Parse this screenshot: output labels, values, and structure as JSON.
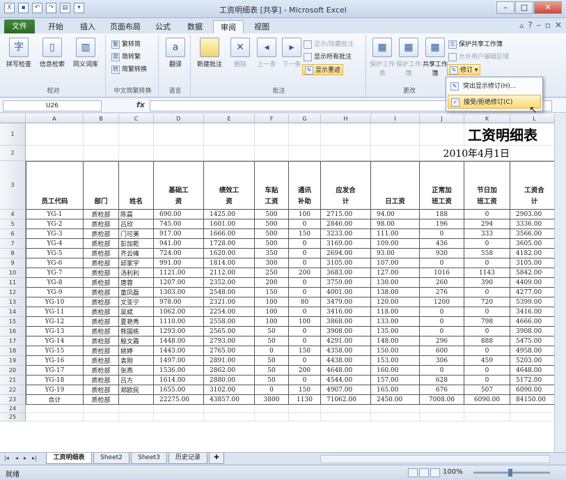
{
  "window": {
    "title": "工资明细表 [共享] - Microsoft Excel"
  },
  "qat": {
    "save_icon": "save-icon",
    "undo_icon": "undo-icon",
    "redo_icon": "redo-icon"
  },
  "tabs": {
    "file": "文件",
    "items": [
      "开始",
      "插入",
      "页面布局",
      "公式",
      "数据",
      "审阅",
      "视图"
    ],
    "active": "审阅"
  },
  "ribbon": {
    "proofing": {
      "label": "校对",
      "spell": "拼写检查",
      "research": "信息检索",
      "thesaurus": "同义词库"
    },
    "chinese": {
      "label": "中文简繁转换",
      "to_simplified": "繁转简",
      "to_traditional": "简转繁",
      "convert": "简繁转换"
    },
    "language": {
      "label": "语言",
      "translate": "翻译"
    },
    "comments": {
      "label": "批注",
      "new": "新建批注",
      "delete": "删除",
      "prev": "上一条",
      "next": "下一条",
      "show_hide": "显示/隐藏批注",
      "show_all": "显示所有批注",
      "show_ink": "显示墨迹"
    },
    "changes": {
      "label": "更改",
      "protect_sheet": "保护工作表",
      "protect_book": "保护工作簿",
      "share_book": "共享工作簿",
      "protect_share": "保护共享工作簿",
      "allow_edit": "允许用户编辑区域",
      "track": "修订"
    }
  },
  "dropdown": {
    "highlight": "突出显示修订(H)...",
    "accept": "接受/拒绝修订(C)"
  },
  "formula": {
    "namebox": "U26",
    "fx": "fx",
    "value": ""
  },
  "columns": [
    "A",
    "B",
    "C",
    "D",
    "E",
    "F",
    "G",
    "H",
    "I",
    "J",
    "K",
    "L"
  ],
  "rows": [
    "1",
    "2",
    "3",
    "4",
    "5",
    "6",
    "7",
    "8",
    "9",
    "10",
    "11",
    "12",
    "13",
    "14",
    "15",
    "16",
    "17",
    "18",
    "19",
    "20",
    "21",
    "22",
    "23",
    "24",
    "25"
  ],
  "sheet": {
    "title": "工资明细表",
    "date": "2010年4月1日",
    "headers": [
      [
        "员工代码"
      ],
      [
        "部门"
      ],
      [
        "姓名"
      ],
      [
        "基础工",
        "资"
      ],
      [
        "绩效工",
        "资"
      ],
      [
        "车贴",
        "工资"
      ],
      [
        "通讯",
        "补助"
      ],
      [
        "应发合",
        "计"
      ],
      [
        "日工资"
      ],
      [
        "正常加",
        "班工资"
      ],
      [
        "节日加",
        "班工资"
      ],
      [
        "工资合",
        "计"
      ]
    ],
    "data": [
      [
        "YG-1",
        "质检部",
        "陈晨",
        "690.00",
        "1425.00",
        "500",
        "100",
        "2715.00",
        "94.00",
        "188",
        "0",
        "2903.00"
      ],
      [
        "YG-2",
        "质检部",
        "吕欣",
        "745.00",
        "1601.00",
        "500",
        "0",
        "2846.00",
        "98.00",
        "196",
        "294",
        "3336.00"
      ],
      [
        "YG-3",
        "质检部",
        "门可美",
        "917.00",
        "1666.00",
        "500",
        "150",
        "3233.00",
        "111.00",
        "0",
        "333",
        "3566.00"
      ],
      [
        "YG-4",
        "质检部",
        "彭加乾",
        "941.00",
        "1728.00",
        "500",
        "0",
        "3169.00",
        "109.00",
        "436",
        "0",
        "3605.00"
      ],
      [
        "YG-5",
        "质检部",
        "齐云峰",
        "724.00",
        "1620.00",
        "350",
        "0",
        "2694.00",
        "93.00",
        "930",
        "558",
        "4182.00"
      ],
      [
        "YG-6",
        "质检部",
        "邱家宇",
        "991.00",
        "1814.00",
        "300",
        "0",
        "3105.00",
        "107.00",
        "0",
        "0",
        "3105.00"
      ],
      [
        "YG-7",
        "质检部",
        "汤利利",
        "1121.00",
        "2112.00",
        "250",
        "200",
        "3683.00",
        "127.00",
        "1016",
        "1143",
        "5842.00"
      ],
      [
        "YG-8",
        "质检部",
        "唐蓉",
        "1207.00",
        "2352.00",
        "200",
        "0",
        "3759.00",
        "130.00",
        "260",
        "390",
        "4409.00"
      ],
      [
        "YG-9",
        "质检部",
        "童凤磊",
        "1303.00",
        "2548.00",
        "150",
        "0",
        "4001.00",
        "138.00",
        "276",
        "0",
        "4277.00"
      ],
      [
        "YG-10",
        "质检部",
        "文亚宁",
        "978.00",
        "2321.00",
        "100",
        "80",
        "3479.00",
        "120.00",
        "1200",
        "720",
        "5399.00"
      ],
      [
        "YG-11",
        "质检部",
        "吴斌",
        "1062.00",
        "2254.00",
        "100",
        "0",
        "3416.00",
        "118.00",
        "0",
        "0",
        "3416.00"
      ],
      [
        "YG-12",
        "质检部",
        "夏艳秀",
        "1110.00",
        "2558.00",
        "100",
        "100",
        "3868.00",
        "133.00",
        "0",
        "798",
        "4666.00"
      ],
      [
        "YG-13",
        "质检部",
        "熊国栋",
        "1293.00",
        "2565.00",
        "50",
        "0",
        "3908.00",
        "135.00",
        "0",
        "0",
        "3908.00"
      ],
      [
        "YG-14",
        "质检部",
        "殷文霞",
        "1448.00",
        "2793.00",
        "50",
        "0",
        "4291.00",
        "148.00",
        "296",
        "888",
        "5475.00"
      ],
      [
        "YG-15",
        "质检部",
        "姚婷",
        "1443.00",
        "2765.00",
        "0",
        "150",
        "4358.00",
        "150.00",
        "600",
        "0",
        "4958.00"
      ],
      [
        "YG-16",
        "质检部",
        "袁刚",
        "1497.00",
        "2891.00",
        "50",
        "0",
        "4438.00",
        "153.00",
        "306",
        "459",
        "5203.00"
      ],
      [
        "YG-17",
        "质检部",
        "张燕",
        "1536.00",
        "2862.00",
        "50",
        "200",
        "4648.00",
        "160.00",
        "0",
        "0",
        "4648.00"
      ],
      [
        "YG-18",
        "质检部",
        "吕方",
        "1614.00",
        "2880.00",
        "50",
        "0",
        "4544.00",
        "157.00",
        "628",
        "0",
        "5172.00"
      ],
      [
        "YG-19",
        "质检部",
        "郑欧民",
        "1655.00",
        "3102.00",
        "0",
        "150",
        "4907.00",
        "165.00",
        "676",
        "507",
        "6090.00"
      ],
      [
        "合计",
        "质检部",
        "",
        "22275.00",
        "43857.00",
        "3800",
        "1130",
        "71062.00",
        "2450.00",
        "7008.00",
        "6090.00",
        "84150.00"
      ]
    ]
  },
  "sheettabs": [
    "工资明细表",
    "Sheet2",
    "Sheet3",
    "历史记录"
  ],
  "status": {
    "ready": "就绪",
    "zoom": "100%"
  }
}
